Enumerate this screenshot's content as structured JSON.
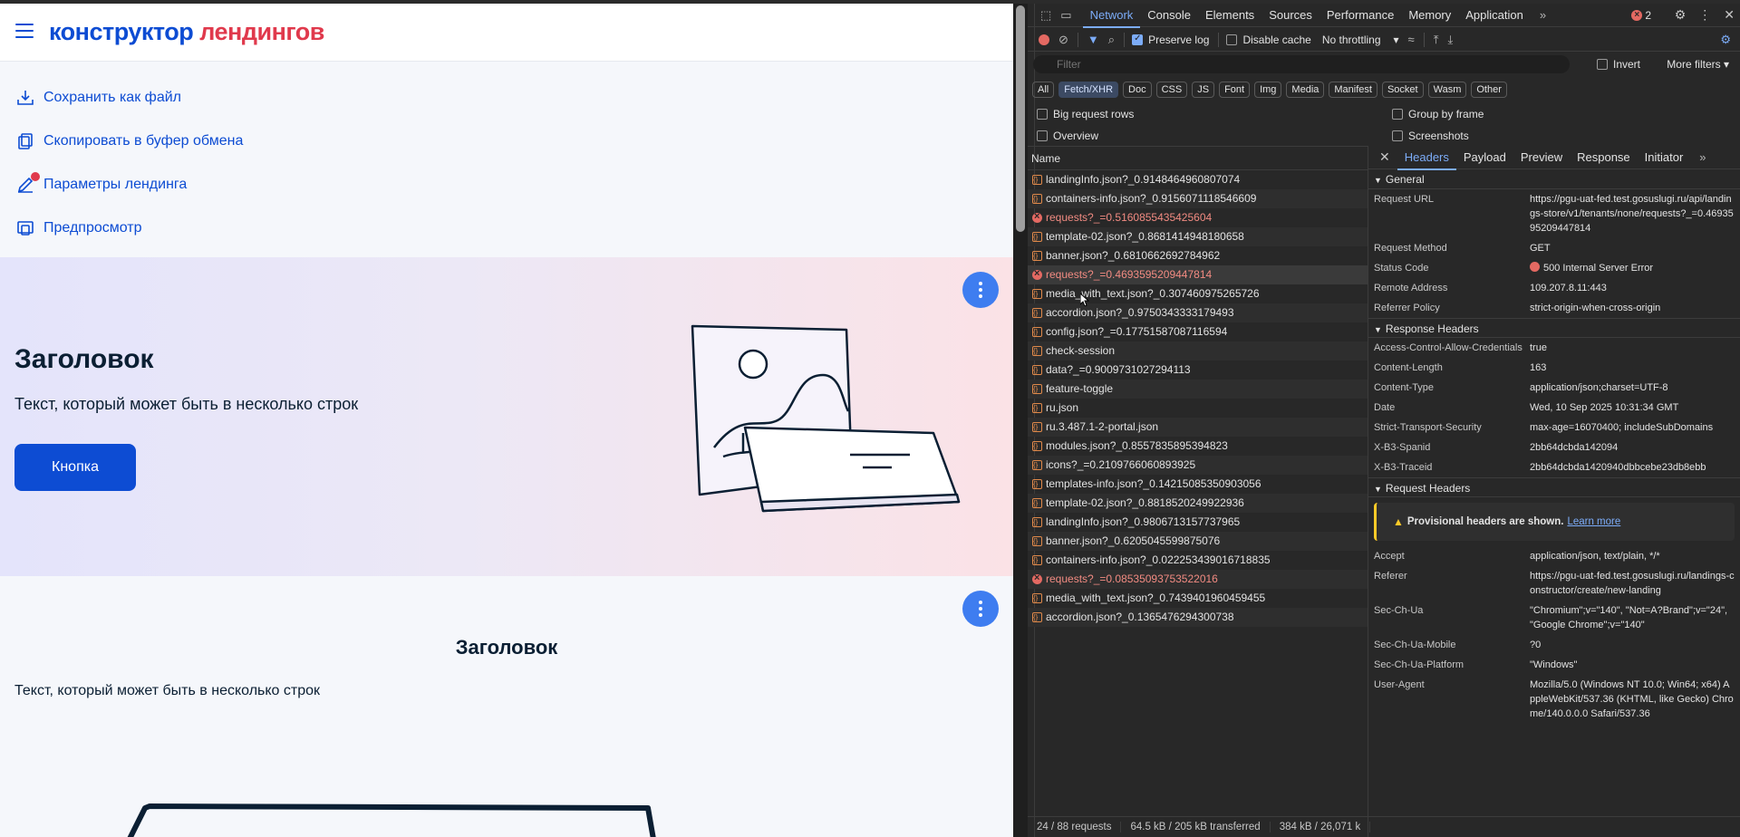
{
  "page": {
    "brand_part1": "конструктор",
    "brand_part2": "лендингов",
    "menu": [
      {
        "label": "Сохранить как файл",
        "icon": "download-icon"
      },
      {
        "label": "Скопировать в буфер обмена",
        "icon": "copy-icon"
      },
      {
        "label": "Параметры лендинга",
        "icon": "edit-icon"
      },
      {
        "label": "Предпросмотр",
        "icon": "preview-icon"
      }
    ],
    "hero": {
      "title": "Заголовок",
      "text": "Текст, который может быть в несколько строк",
      "button": "Кнопка"
    },
    "section2": {
      "title": "Заголовок",
      "text": "Текст, который может быть в несколько строк"
    }
  },
  "devtools": {
    "tabs": [
      "Network",
      "Console",
      "Elements",
      "Sources",
      "Performance",
      "Memory",
      "Application"
    ],
    "active_tab": "Network",
    "error_count": "2",
    "toolbar": {
      "preserve_log": "Preserve log",
      "disable_cache": "Disable cache",
      "throttling": "No throttling"
    },
    "filter": {
      "placeholder": "Filter",
      "invert": "Invert",
      "more_filters": "More filters"
    },
    "types": [
      "All",
      "Fetch/XHR",
      "Doc",
      "CSS",
      "JS",
      "Font",
      "Img",
      "Media",
      "Manifest",
      "Socket",
      "Wasm",
      "Other"
    ],
    "active_type": "Fetch/XHR",
    "options": {
      "big_rows": "Big request rows",
      "group_by_frame": "Group by frame",
      "overview": "Overview",
      "screenshots": "Screenshots"
    },
    "name_header": "Name",
    "requests": [
      {
        "name": "landingInfo.json?_0.9148464960807074",
        "error": false
      },
      {
        "name": "containers-info.json?_0.9156071118546609",
        "error": false
      },
      {
        "name": "requests?_=0.5160855435425604",
        "error": true
      },
      {
        "name": "template-02.json?_0.8681414948180658",
        "error": false
      },
      {
        "name": "banner.json?_0.6810662692784962",
        "error": false
      },
      {
        "name": "requests?_=0.4693595209447814",
        "error": true
      },
      {
        "name": "media_with_text.json?_0.307460975265726",
        "error": false
      },
      {
        "name": "accordion.json?_0.9750343333179493",
        "error": false
      },
      {
        "name": "config.json?_=0.17751587087116594",
        "error": false
      },
      {
        "name": "check-session",
        "error": false
      },
      {
        "name": "data?_=0.9009731027294113",
        "error": false
      },
      {
        "name": "feature-toggle",
        "error": false
      },
      {
        "name": "ru.json",
        "error": false
      },
      {
        "name": "ru.3.487.1-2-portal.json",
        "error": false
      },
      {
        "name": "modules.json?_0.8557835895394823",
        "error": false
      },
      {
        "name": "icons?_=0.2109766060893925",
        "error": false
      },
      {
        "name": "templates-info.json?_0.14215085350903056",
        "error": false
      },
      {
        "name": "template-02.json?_0.8818520249922936",
        "error": false
      },
      {
        "name": "landingInfo.json?_0.9806713157737965",
        "error": false
      },
      {
        "name": "banner.json?_0.6205045599875076",
        "error": false
      },
      {
        "name": "containers-info.json?_0.022253439016718835",
        "error": false
      },
      {
        "name": "requests?_=0.08535093753522016",
        "error": true
      },
      {
        "name": "media_with_text.json?_0.7439401960459455",
        "error": false
      },
      {
        "name": "accordion.json?_0.1365476294300738",
        "error": false
      }
    ],
    "detail_tabs": [
      "Headers",
      "Payload",
      "Preview",
      "Response",
      "Initiator"
    ],
    "active_detail_tab": "Headers",
    "general_title": "General",
    "general": [
      {
        "k": "Request URL",
        "v": "https://pgu-uat-fed.test.gosuslugi.ru/api/landings-store/v1/tenants/none/requests?_=0.4693595209447814"
      },
      {
        "k": "Request Method",
        "v": "GET"
      },
      {
        "k": "Status Code",
        "v": "500 Internal Server Error"
      },
      {
        "k": "Remote Address",
        "v": "109.207.8.11:443"
      },
      {
        "k": "Referrer Policy",
        "v": "strict-origin-when-cross-origin"
      }
    ],
    "response_headers_title": "Response Headers",
    "response_headers": [
      {
        "k": "Access-Control-Allow-Credentials",
        "v": "true"
      },
      {
        "k": "Content-Length",
        "v": "163"
      },
      {
        "k": "Content-Type",
        "v": "application/json;charset=UTF-8"
      },
      {
        "k": "Date",
        "v": "Wed, 10 Sep 2025 10:31:34 GMT"
      },
      {
        "k": "Strict-Transport-Security",
        "v": "max-age=16070400; includeSubDomains"
      },
      {
        "k": "X-B3-Spanid",
        "v": "2bb64dcbda142094"
      },
      {
        "k": "X-B3-Traceid",
        "v": "2bb64dcbda1420940dbbcebe23db8ebb"
      }
    ],
    "request_headers_title": "Request Headers",
    "provisional": "Provisional headers are shown.",
    "learn_more": "Learn more",
    "request_headers": [
      {
        "k": "Accept",
        "v": "application/json, text/plain, */*"
      },
      {
        "k": "Referer",
        "v": "https://pgu-uat-fed.test.gosuslugi.ru/landings-constructor/create/new-landing"
      },
      {
        "k": "Sec-Ch-Ua",
        "v": "\"Chromium\";v=\"140\", \"Not=A?Brand\";v=\"24\", \"Google Chrome\";v=\"140\""
      },
      {
        "k": "Sec-Ch-Ua-Mobile",
        "v": "?0"
      },
      {
        "k": "Sec-Ch-Ua-Platform",
        "v": "\"Windows\""
      },
      {
        "k": "User-Agent",
        "v": "Mozilla/5.0 (Windows NT 10.0; Win64; x64) AppleWebKit/537.36 (KHTML, like Gecko) Chrome/140.0.0.0 Safari/537.36"
      }
    ],
    "status_bar": {
      "requests": "24 / 88 requests",
      "transferred": "64.5 kB / 205 kB transferred",
      "resources": "384 kB / 26,071 k"
    },
    "colors": {
      "accent": "#7cacf8",
      "error": "#e46962",
      "brand_blue": "#0d4cd3",
      "brand_red": "#e0394c"
    }
  }
}
